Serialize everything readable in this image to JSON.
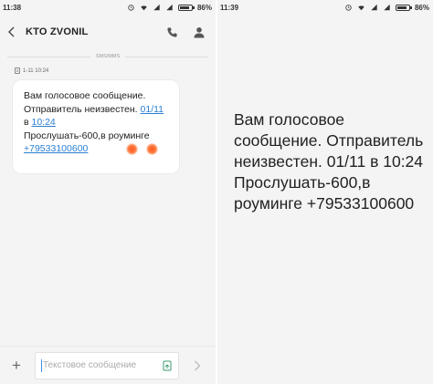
{
  "left_screen": {
    "status_bar": {
      "time": "11:38",
      "battery_percent": 86,
      "battery_label": "86%"
    },
    "header": {
      "title": "KTO ZVONIL"
    },
    "divider_label": "SMS/MMS",
    "message": {
      "sim_slot": "2",
      "timestamp": "1-11 10:24",
      "text_part1": "Вам голосовое сообщение. Отправитель неизвестен. ",
      "date_link": "01/11",
      "text_part2": " в ",
      "time_link": "10:24",
      "text_part3": "Прослушать-600,в роуминге",
      "phone_link": "+79533100600"
    },
    "composer": {
      "placeholder": "Текстовое сообщение",
      "plus_label": "+"
    }
  },
  "right_screen": {
    "status_bar": {
      "time": "11:39",
      "battery_percent": 86,
      "battery_label": "86%"
    },
    "big_text": "Вам голосовое сообщение. Отправитель неизвестен. 01/11 в 10:24 Прослушать-600,в роуминге +79533100600"
  },
  "colors": {
    "link": "#2a7fd4",
    "background": "#f4f4f4",
    "bubble": "#ffffff",
    "redaction_blob": "#ff5a20"
  },
  "icons": [
    "wifi-icon",
    "signal-icon",
    "alarm-icon",
    "battery-icon",
    "back-arrow-icon",
    "phone-icon",
    "contact-icon",
    "attach-icon",
    "send-icon",
    "plus-icon"
  ]
}
